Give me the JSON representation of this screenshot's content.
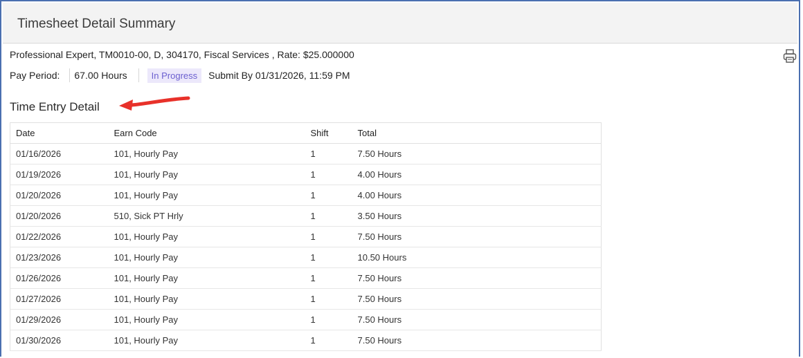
{
  "panel": {
    "title": "Timesheet Detail Summary"
  },
  "position_info": "Professional Expert, TM0010-00, D, 304170, Fiscal Services , Rate: $25.000000",
  "pay_period": {
    "label": "Pay Period:",
    "hours": "67.00 Hours",
    "status": "In Progress",
    "submit_by": "Submit By 01/31/2026, 11:59 PM"
  },
  "section": {
    "title": "Time Entry Detail"
  },
  "table": {
    "headers": [
      "Date",
      "Earn Code",
      "Shift",
      "Total"
    ],
    "rows": [
      [
        "01/16/2026",
        "101, Hourly Pay",
        "1",
        "7.50 Hours"
      ],
      [
        "01/19/2026",
        "101, Hourly Pay",
        "1",
        "4.00 Hours"
      ],
      [
        "01/20/2026",
        "101, Hourly Pay",
        "1",
        "4.00 Hours"
      ],
      [
        "01/20/2026",
        "510, Sick PT Hrly",
        "1",
        "3.50 Hours"
      ],
      [
        "01/22/2026",
        "101, Hourly Pay",
        "1",
        "7.50 Hours"
      ],
      [
        "01/23/2026",
        "101, Hourly Pay",
        "1",
        "10.50 Hours"
      ],
      [
        "01/26/2026",
        "101, Hourly Pay",
        "1",
        "7.50 Hours"
      ],
      [
        "01/27/2026",
        "101, Hourly Pay",
        "1",
        "7.50 Hours"
      ],
      [
        "01/29/2026",
        "101, Hourly Pay",
        "1",
        "7.50 Hours"
      ],
      [
        "01/30/2026",
        "101, Hourly Pay",
        "1",
        "7.50 Hours"
      ]
    ]
  },
  "icons": {
    "print": "printer-icon",
    "annotation": "red-arrow-icon"
  },
  "colors": {
    "frame_border": "#4a6fb0",
    "badge_bg": "#ece8fb",
    "badge_text": "#6b5fcf",
    "arrow": "#e8312a"
  }
}
